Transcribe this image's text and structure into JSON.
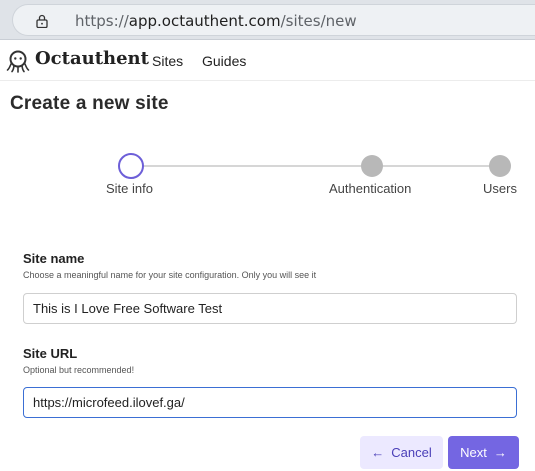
{
  "browser": {
    "url_prefix": "https://",
    "url_host": "app.octauthent.com",
    "url_path": "/sites/new"
  },
  "app": {
    "brand": "Octauthent",
    "nav": [
      "Sites",
      "Guides"
    ]
  },
  "page": {
    "title": "Create a new site"
  },
  "stepper": {
    "steps": [
      "Site info",
      "Authentication",
      "Users"
    ],
    "active_index": 0,
    "active_color": "#6d5fd8"
  },
  "form": {
    "site_name": {
      "label": "Site name",
      "help": "Choose a meaningful name for your site configuration. Only you will see it",
      "value": "This is I Love Free Software Test"
    },
    "site_url": {
      "label": "Site URL",
      "help": "Optional but recommended!",
      "value": "https://microfeed.ilovef.ga/"
    }
  },
  "actions": {
    "cancel_label": "Cancel",
    "cancel_icon": "arrow-left-icon",
    "next_label": "Next",
    "next_icon": "arrow-right-icon",
    "primary_color": "#7466e2"
  }
}
